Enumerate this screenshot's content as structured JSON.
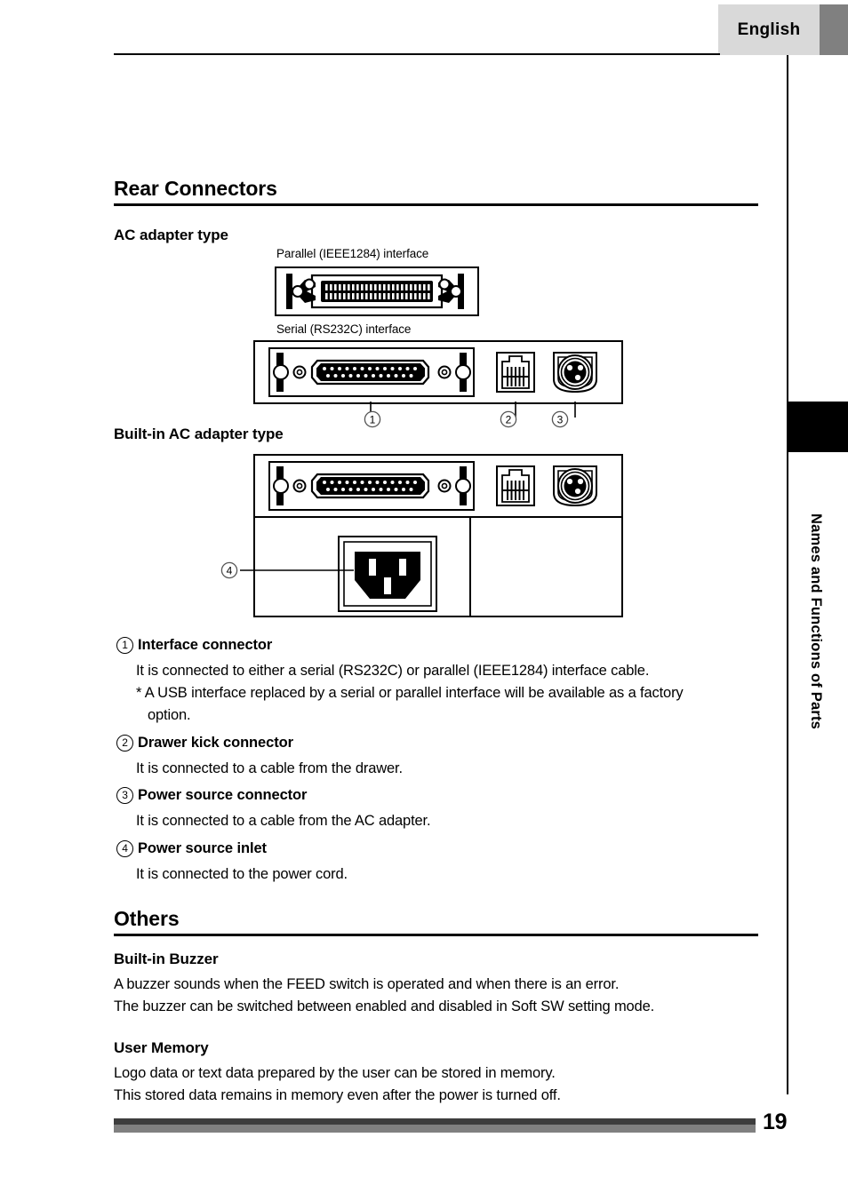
{
  "header": {
    "language_tab": "English"
  },
  "side_tab": {
    "chapter_title": "Names and Functions of Parts"
  },
  "sections": {
    "rear_connectors": {
      "title": "Rear Connectors",
      "ac_adapter_type": {
        "title": "AC adapter type",
        "parallel_label": "Parallel (IEEE1284) interface",
        "serial_label": "Serial (RS232C) interface",
        "callouts": [
          "1",
          "2",
          "3"
        ]
      },
      "builtin_ac_adapter_type": {
        "title": "Built-in AC adapter type",
        "callouts": [
          "4"
        ]
      },
      "items": [
        {
          "number": "1",
          "label": "Interface connector",
          "lines": [
            "It is connected to either a serial (RS232C) or parallel (IEEE1284) interface cable.",
            "* A USB interface replaced by a serial or parallel interface will be available as a factory",
            "option."
          ]
        },
        {
          "number": "2",
          "label": "Drawer kick connector",
          "lines": [
            "It is connected to a cable from the drawer."
          ]
        },
        {
          "number": "3",
          "label": "Power source connector",
          "lines": [
            "It is connected to a cable from the AC adapter."
          ]
        },
        {
          "number": "4",
          "label": "Power source inlet",
          "lines": [
            "It is connected to the power cord."
          ]
        }
      ]
    },
    "others": {
      "title": "Others",
      "subsections": [
        {
          "title": "Built-in Buzzer",
          "lines": [
            "A buzzer sounds when the FEED switch is operated and when there is an error.",
            "The buzzer can be switched between enabled and disabled in Soft SW setting mode."
          ]
        },
        {
          "title": "User Memory",
          "lines": [
            "Logo data or text data prepared by the user can be stored in memory.",
            "This stored data remains in memory even after the power is turned off."
          ]
        }
      ]
    }
  },
  "footer": {
    "page_number": "19"
  },
  "colors": {
    "lang_tab_bg": "#d9d9d9",
    "lang_tab_block": "#808080",
    "footer_dark": "#3d3d3d",
    "footer_light": "#808080",
    "ink": "#000000"
  }
}
